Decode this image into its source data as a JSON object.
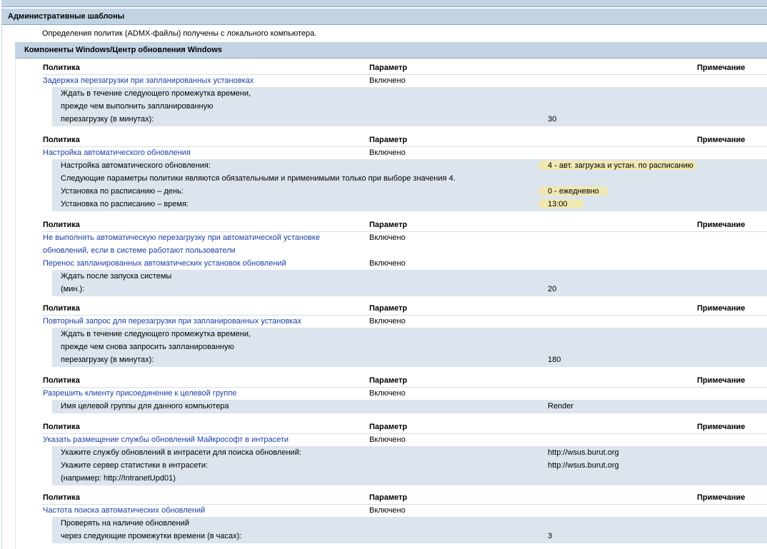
{
  "section": {
    "title": "Административные шаблоны",
    "note": "Определения политик (ADMX-файлы) получены с локального компьютера."
  },
  "component": {
    "title": "Компоненты Windows/Центр обновления Windows"
  },
  "columns": {
    "policy": "Политика",
    "param": "Параметр",
    "comment": "Примечание"
  },
  "groups": [
    {
      "policies": [
        {
          "name": "Задержка перезагрузки при запланированных установках",
          "state": "Включено"
        }
      ],
      "settings": [
        {
          "label": "Ждать в течение следующего промежутка времени,",
          "value": ""
        },
        {
          "label": "прежде чем выполнить запланированную",
          "value": ""
        },
        {
          "label": "перезагрузку (в минутах):",
          "value": "30"
        }
      ]
    },
    {
      "policies": [
        {
          "name": "Настройка автоматического обновления",
          "state": "Включено"
        }
      ],
      "settings": [
        {
          "label": "Настройка автоматического обновления:",
          "value": "4 - авт. загрузка и устан. по расписанию"
        },
        {
          "label": "Следующие параметры политики являются обязательными и применимыми только при выборе значения 4.",
          "value": ""
        },
        {
          "label": "Установка по расписанию – день:",
          "value": "0 - ежедневно"
        },
        {
          "label": "Установка по расписанию – время:",
          "value": "13:00"
        }
      ]
    },
    {
      "policies": [
        {
          "name": "Не выполнять автоматическую перезагрузку при автоматической установке",
          "name2": "обновлений, если в системе работают пользователи",
          "state": "Включено"
        },
        {
          "name": "Перенос запланированных автоматических установок обновлений",
          "state": "Включено"
        }
      ],
      "settings": [
        {
          "label": "Ждать после запуска системы",
          "value": ""
        },
        {
          "label": "(мин.):",
          "value": "20"
        }
      ]
    },
    {
      "policies": [
        {
          "name": "Повторный запрос для перезагрузки при запланированных установках",
          "state": "Включено"
        }
      ],
      "settings": [
        {
          "label": "Ждать в течение следующего промежутка времени,",
          "value": ""
        },
        {
          "label": "прежде чем снова запросить запланированную",
          "value": ""
        },
        {
          "label": "перезагрузку (в минутах):",
          "value": "180"
        }
      ]
    },
    {
      "policies": [
        {
          "name": "Разрешить клиенту присоединение к целевой группе",
          "state": "Включено"
        }
      ],
      "settings": [
        {
          "label": "Имя целевой группы для данного компьютера",
          "value": "Render"
        }
      ]
    },
    {
      "policies": [
        {
          "name": "Указать размещение службы обновлений Майкрософт в интрасети",
          "state": "Включено"
        }
      ],
      "settings": [
        {
          "label": "Укажите службу обновлений в интрасети для поиска обновлений:",
          "value": "http://wsus.burut.org"
        },
        {
          "label": "Укажите сервер статистики в интрасети:",
          "value": "http://wsus.burut.org"
        },
        {
          "label": "(например: http://IntranetUpd01)",
          "value": ""
        }
      ]
    },
    {
      "policies": [
        {
          "name": "Частота поиска автоматических обновлений",
          "state": "Включено"
        }
      ],
      "settings": [
        {
          "label": "Проверять на наличие обновлений",
          "value": ""
        },
        {
          "label": "через следующие промежутки времени (в часах):",
          "value": "3"
        }
      ]
    }
  ]
}
